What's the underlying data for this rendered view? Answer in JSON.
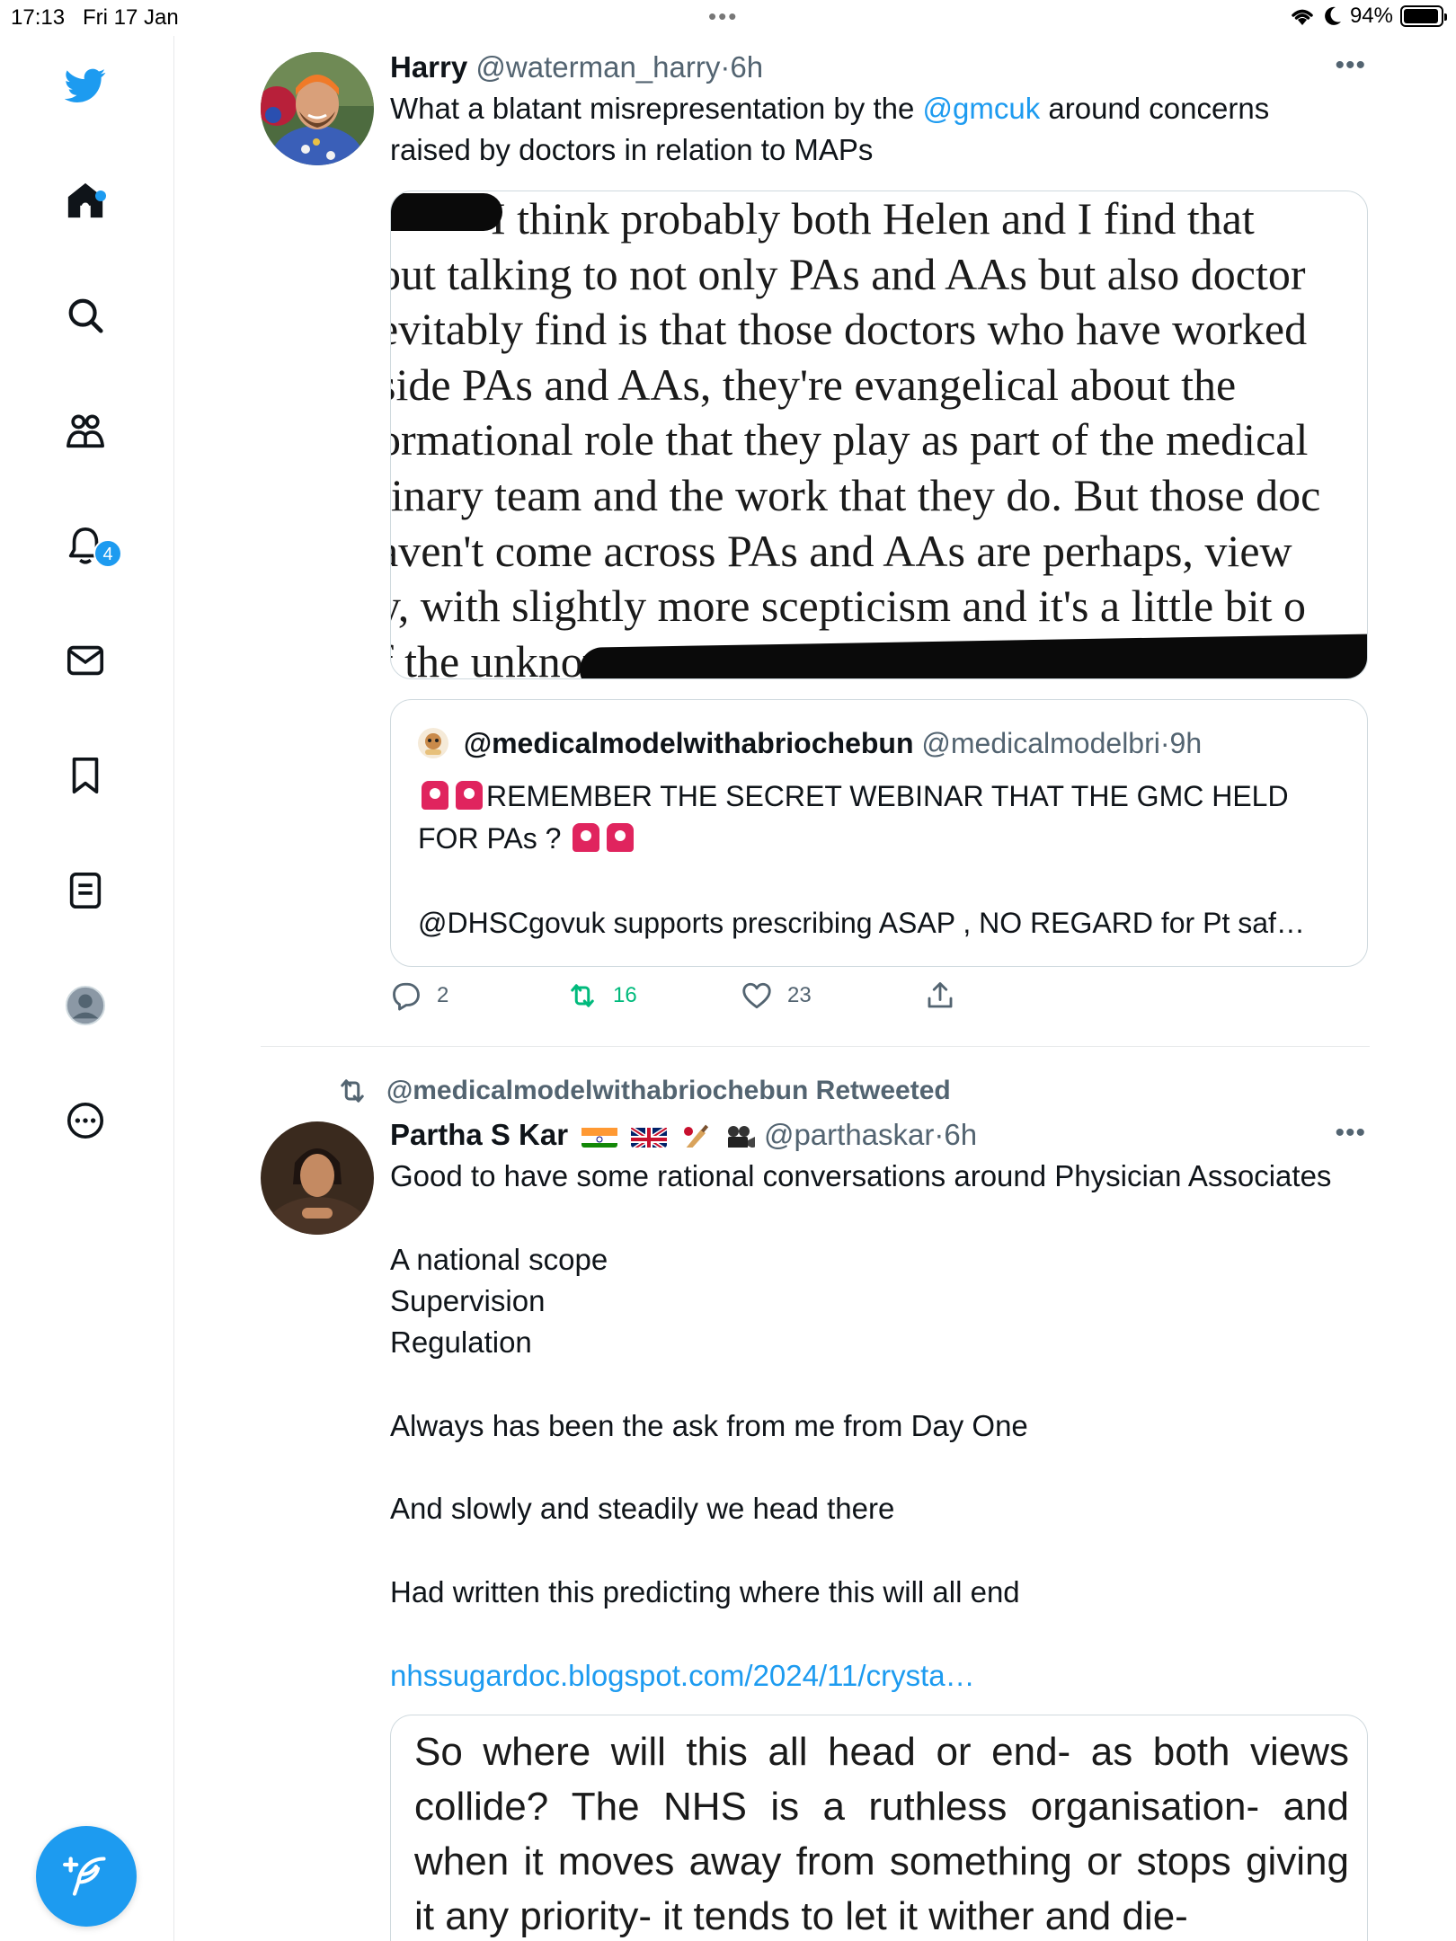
{
  "status_bar": {
    "time": "17:13",
    "date": "Fri 17 Jan",
    "battery": "94%",
    "battery_level": 0.94
  },
  "sidebar": {
    "items": [
      {
        "name": "twitter-logo-icon"
      },
      {
        "name": "home-icon",
        "has_dot": true
      },
      {
        "name": "search-icon"
      },
      {
        "name": "communities-icon"
      },
      {
        "name": "notifications-icon",
        "badge": "4"
      },
      {
        "name": "messages-icon"
      },
      {
        "name": "bookmarks-icon"
      },
      {
        "name": "lists-icon"
      },
      {
        "name": "profile-icon"
      },
      {
        "name": "more-icon"
      }
    ],
    "compose_icon": "compose-icon",
    "accent": "#1d9bf0"
  },
  "tweet1": {
    "name": "Harry",
    "handle": "@waterman_harry",
    "sep": "·",
    "time": "6h",
    "text_before": "What a blatant misrepresentation by the ",
    "mention": "@gmcuk",
    "text_after": " around concerns raised by doctors in relation to MAPs",
    "image_lines": [
      "          I think probably both Helen and I find that",
      "out talking to not only PAs and AAs but also doctor",
      "evitably find is that those doctors who have worked",
      "side PAs and AAs, they're evangelical about the",
      "ormational role that they play as part of the medical",
      "linary team and the work that they do. But those doc",
      "aven't come across PAs and AAs are perhaps, view",
      "y, with slightly more scepticism and it's a little bit o",
      "f the unknown"
    ],
    "quote": {
      "name": "@medicalmodelwithabriochebun",
      "handle": "@medicalmodelbri",
      "sep": "·",
      "time": "9h",
      "line1": "REMEMBER THE SECRET WEBINAR THAT THE GMC HELD",
      "line2": "FOR PAs ?",
      "line3": "@DHSCgovuk supports prescribing ASAP , NO REGARD for Pt saf…"
    },
    "actions": {
      "replies": "2",
      "retweets": "16",
      "likes": "23"
    },
    "retweet_color": "#00ba7c"
  },
  "tweet2": {
    "retweeted_by": "@medicalmodelwithabriochebun Retweeted",
    "name": "Partha S Kar",
    "handle": "@parthaskar",
    "sep": "·",
    "time": "6h",
    "text": "Good to have some rational conversations around Physician Associates\n\nA national scope\nSupervision\nRegulation\n\nAlways has been the ask from me from Day One\n\nAnd slowly and steadily we head there\n\nHad written this predicting where this will all end\n",
    "link": "nhssugardoc.blogspot.com/2024/11/crysta…",
    "article_text": "So where will this all head or end- as both views collide? The NHS is a ruthless organisation- and when it moves away from something or stops giving it any priority- it tends to let it wither and die-"
  }
}
